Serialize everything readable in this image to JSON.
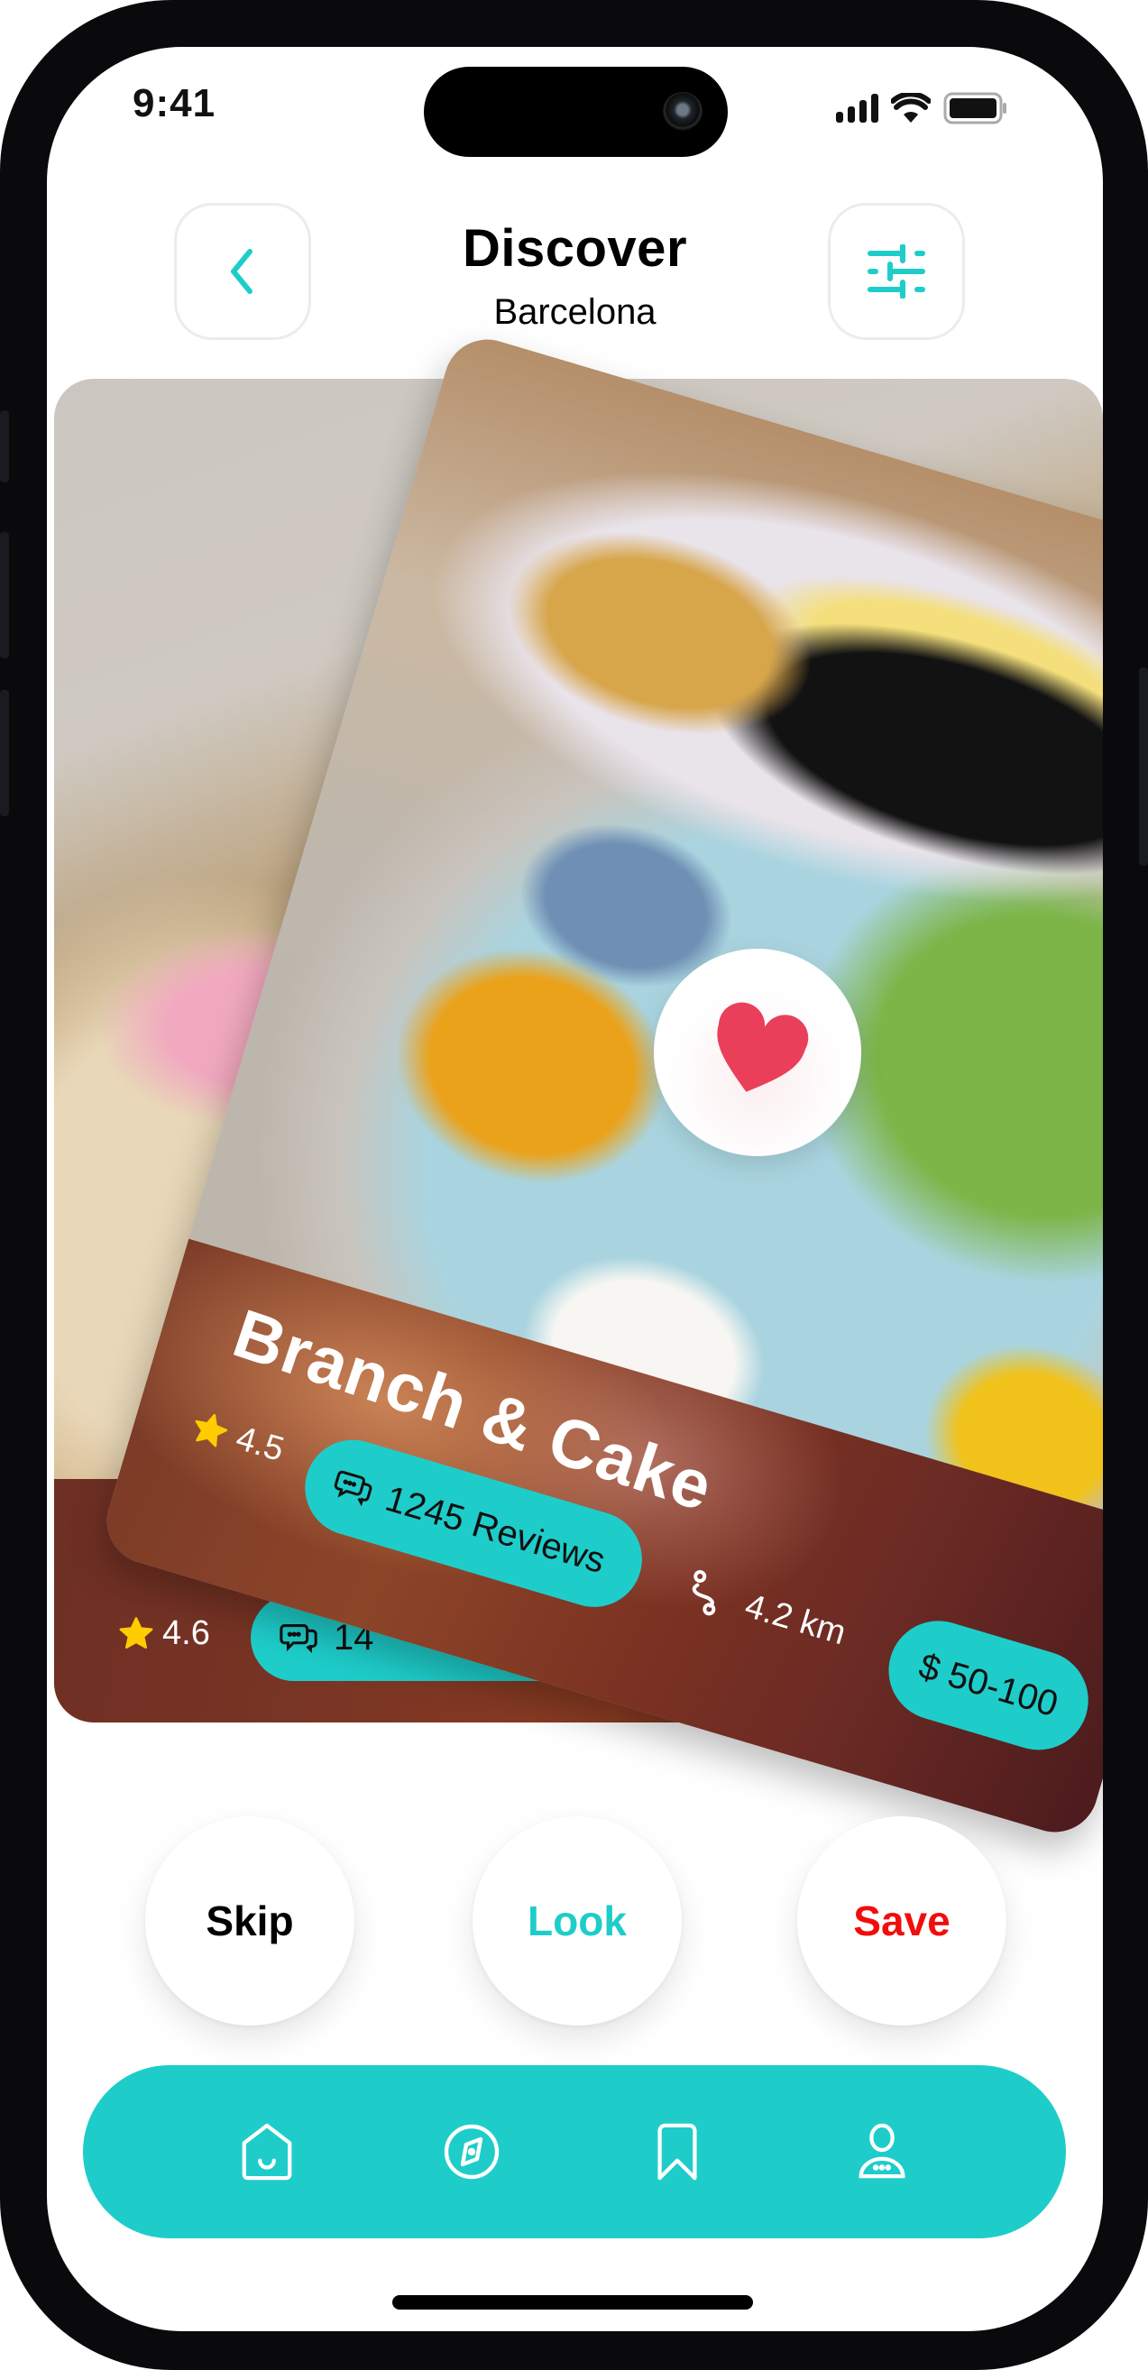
{
  "status_bar": {
    "time": "9:41",
    "icons": [
      "signal-icon",
      "wifi-icon",
      "battery-icon"
    ]
  },
  "header": {
    "back_icon": "chevron-left-icon",
    "title": "Discover",
    "subtitle": "Barcelona",
    "filter_icon": "sliders-icon"
  },
  "cards": {
    "back_card": {
      "rating": "4.6",
      "reviews_visible": "14",
      "icons": [
        "star-icon",
        "chat-bubbles-icon"
      ]
    },
    "front_card": {
      "name": "Branch & Cake",
      "rating": "4.5",
      "reviews": "1245 Reviews",
      "distance": "4.2 km",
      "price": "$ 50-100",
      "favorite_icon": "heart-icon"
    }
  },
  "actions": {
    "skip": "Skip",
    "look": "Look",
    "save": "Save"
  },
  "bottom_nav": {
    "items": [
      {
        "name": "home",
        "icon": "home-icon"
      },
      {
        "name": "explore",
        "icon": "compass-icon"
      },
      {
        "name": "saved",
        "icon": "bookmark-icon"
      },
      {
        "name": "profile",
        "icon": "user-icon"
      }
    ]
  },
  "colors": {
    "accent": "#1ECDCA",
    "save": "#F20D0D",
    "heart": "#EA3F5A",
    "star": "#FFCC00",
    "card_info": "#7A3524"
  }
}
